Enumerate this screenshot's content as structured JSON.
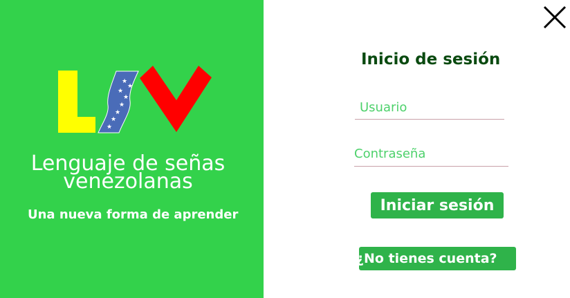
{
  "brand": {
    "logo_text": "LSV",
    "title_line1": "Lenguaje de señas",
    "title_line2": "venezolanas",
    "tagline": "Una nueva forma de aprender"
  },
  "login": {
    "title": "Inicio de sesión",
    "username_placeholder": "Usuario",
    "password_placeholder": "Contraseña",
    "submit_label": "Iniciar sesión",
    "register_label": "¿No tienes cuenta?"
  },
  "icons": {
    "close": "close-icon"
  },
  "colors": {
    "panel_green": "#33d24b",
    "button_green": "#2fb34a",
    "title_dark_green": "#0a4a10",
    "logo_yellow": "#ffff00",
    "logo_blue": "#4a6cb8",
    "logo_red": "#ff0000"
  }
}
